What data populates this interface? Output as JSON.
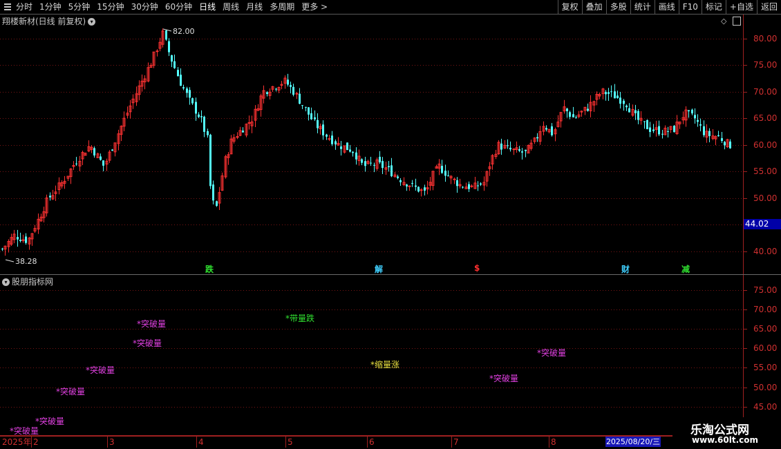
{
  "toolbar": {
    "periods": [
      "分时",
      "1分钟",
      "5分钟",
      "15分钟",
      "30分钟",
      "60分钟",
      "日线",
      "周线",
      "月线",
      "多周期",
      "更多"
    ],
    "active": "日线",
    "right": [
      "复权",
      "叠加",
      "多股",
      "统计",
      "画线",
      "F10",
      "标记",
      "+自选",
      "返回"
    ]
  },
  "main": {
    "title": "翔楼新材(日线 前复权)",
    "price_ticks": [
      "80.00",
      "75.00",
      "70.00",
      "65.00",
      "60.00",
      "55.00",
      "50.00",
      "45.00",
      "40.00"
    ],
    "current_price": "44.02",
    "high_label": "82.00",
    "low_label": "38.28",
    "events": [
      {
        "text": "跌",
        "color": "#30e030"
      },
      {
        "text": "解",
        "color": "#40d0ff"
      },
      {
        "text": "$",
        "color": "#ff3030"
      },
      {
        "text": "财",
        "color": "#40d0ff"
      },
      {
        "text": "减",
        "color": "#30e030"
      }
    ]
  },
  "indicator": {
    "title": "股朋指标网",
    "ticks": [
      "75.00",
      "70.00",
      "65.00",
      "60.00",
      "55.00",
      "50.00",
      "45.00"
    ],
    "signals": [
      {
        "text": "*突破量",
        "color": "#e040e0"
      },
      {
        "text": "*突破量",
        "color": "#e040e0"
      },
      {
        "text": "*突破量",
        "color": "#e040e0"
      },
      {
        "text": "*突破量",
        "color": "#e040e0"
      },
      {
        "text": "*突破量",
        "color": "#e040e0"
      },
      {
        "text": "*突破量",
        "color": "#e040e0"
      },
      {
        "text": "*带量跌",
        "color": "#30e030"
      },
      {
        "text": "*缩量涨",
        "color": "#e8e040"
      },
      {
        "text": "*突破量",
        "color": "#e040e0"
      },
      {
        "text": "*突破量",
        "color": "#e040e0"
      }
    ]
  },
  "date_axis": {
    "labels": [
      "2025年",
      "2",
      "3",
      "4",
      "5",
      "6",
      "7",
      "8"
    ],
    "cursor_date": "2025/08/20/三"
  },
  "watermark": {
    "line1": "乐淘公式网",
    "line2": "www.60lt.com"
  },
  "colors": {
    "up": "#ff3232",
    "down": "#54ffff",
    "axis": "#a02020",
    "grid": "#7a1515"
  }
}
